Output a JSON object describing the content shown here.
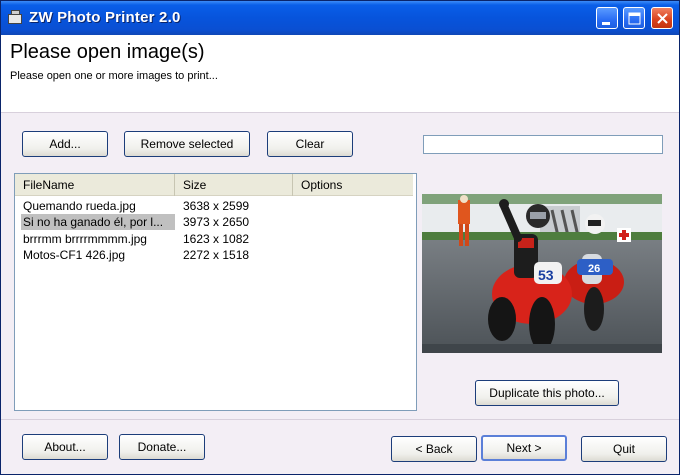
{
  "window": {
    "title": "ZW Photo Printer 2.0"
  },
  "header": {
    "title": "Please open image(s)",
    "subtitle": "Please open one or more images to print..."
  },
  "toolbar": {
    "add": "Add...",
    "remove": "Remove selected",
    "clear": "Clear"
  },
  "progress": {
    "value": 0
  },
  "list": {
    "columns": [
      "FileName",
      "Size",
      "Options"
    ],
    "rows": [
      {
        "name": "Quemando rueda.jpg",
        "size": "3638 x 2599",
        "options": ""
      },
      {
        "name": "Si no ha ganado él, por l...",
        "size": "3973 x 2650",
        "options": "",
        "selected": true
      },
      {
        "name": "brrrmm brrrrmmmm.jpg",
        "size": "1623 x 1082",
        "options": ""
      },
      {
        "name": "Motos-CF1 426.jpg",
        "size": "2272 x 1518",
        "options": ""
      }
    ]
  },
  "preview": {
    "duplicate": "Duplicate this photo...",
    "bike_numbers": [
      "53",
      "26"
    ]
  },
  "footer": {
    "about": "About...",
    "donate": "Donate...",
    "back": "< Back",
    "next": "Next >",
    "quit": "Quit"
  },
  "colors": {
    "titlebar": "#0754dc",
    "window_bg": "#f3eef5",
    "selection": "#c0c0c0",
    "close": "#d8401c"
  }
}
